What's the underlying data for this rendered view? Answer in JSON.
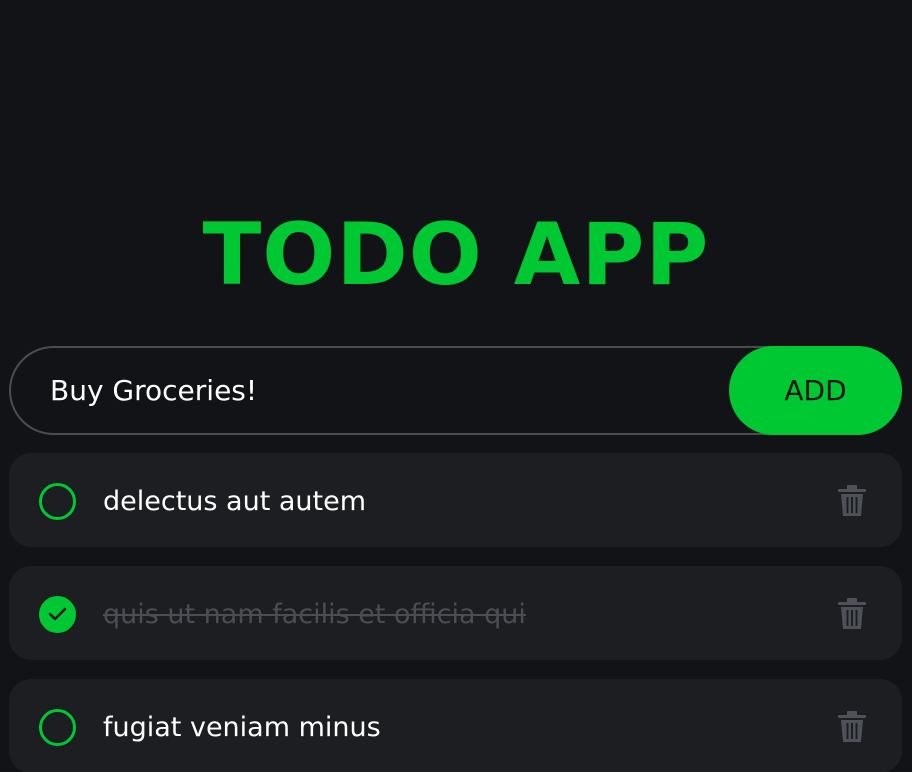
{
  "app": {
    "title": "TODO APP",
    "accent_color": "#00c832",
    "background_color": "#111317",
    "card_color": "#1d1e22",
    "muted_color": "#4b4d53"
  },
  "form": {
    "input_value": "Buy Groceries!",
    "add_label": "ADD"
  },
  "todos": [
    {
      "text": "delectus aut autem",
      "completed": false,
      "check_icon": "circle-icon",
      "delete_icon": "trash-icon"
    },
    {
      "text": "quis ut nam facilis et officia qui",
      "completed": true,
      "check_icon": "check-circle-icon",
      "delete_icon": "trash-icon"
    },
    {
      "text": "fugiat veniam minus",
      "completed": false,
      "check_icon": "circle-icon",
      "delete_icon": "trash-icon"
    }
  ]
}
